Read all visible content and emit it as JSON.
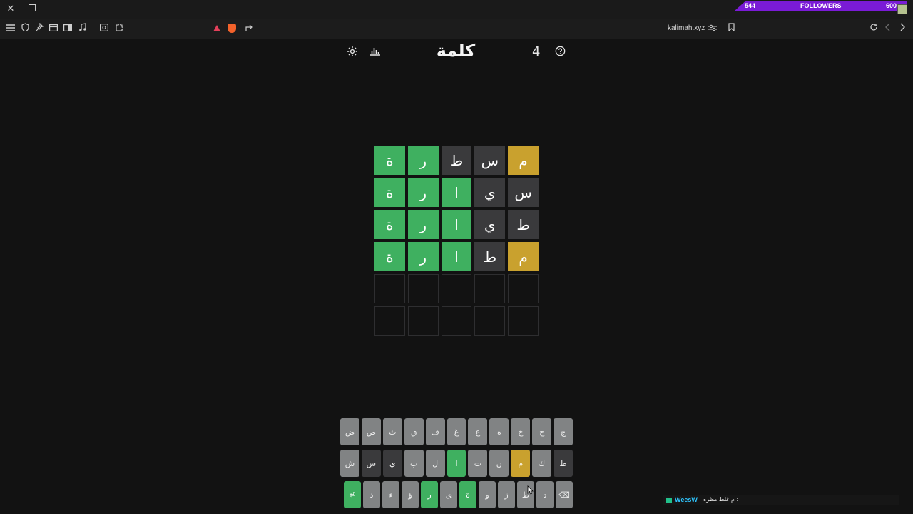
{
  "browser": {
    "url": "kalimah.xyz",
    "window_controls": {
      "close": "✕",
      "restore": "❐",
      "minimize": "–"
    },
    "toolbar_left_icons": [
      "menu-icon",
      "shield-icon",
      "pin-icon",
      "tab-icon",
      "sidebar-icon",
      "music-icon",
      "screenshot-icon",
      "puzzle-icon"
    ],
    "toolbar_right_icons": [
      "tune-icon",
      "bookmark-icon",
      "reload-icon",
      "back-icon",
      "forward-icon"
    ]
  },
  "overlay": {
    "followers_label": "FOLLOWERS",
    "followers_current": "544",
    "followers_goal": "600"
  },
  "header": {
    "title": "كلمة",
    "count": "4",
    "icons": [
      "settings-icon",
      "stats-icon",
      "help-icon"
    ]
  },
  "board": {
    "rows": [
      [
        {
          "l": "م",
          "s": "present"
        },
        {
          "l": "س",
          "s": "absent"
        },
        {
          "l": "ط",
          "s": "absent"
        },
        {
          "l": "ر",
          "s": "correct"
        },
        {
          "l": "ة",
          "s": "correct"
        }
      ],
      [
        {
          "l": "س",
          "s": "absent"
        },
        {
          "l": "ي",
          "s": "absent"
        },
        {
          "l": "ا",
          "s": "correct"
        },
        {
          "l": "ر",
          "s": "correct"
        },
        {
          "l": "ة",
          "s": "correct"
        }
      ],
      [
        {
          "l": "ط",
          "s": "absent"
        },
        {
          "l": "ي",
          "s": "absent"
        },
        {
          "l": "ا",
          "s": "correct"
        },
        {
          "l": "ر",
          "s": "correct"
        },
        {
          "l": "ة",
          "s": "correct"
        }
      ],
      [
        {
          "l": "م",
          "s": "present"
        },
        {
          "l": "ط",
          "s": "absent"
        },
        {
          "l": "ا",
          "s": "correct"
        },
        {
          "l": "ر",
          "s": "correct"
        },
        {
          "l": "ة",
          "s": "correct"
        }
      ],
      [
        {
          "l": "",
          "s": "empty"
        },
        {
          "l": "",
          "s": "empty"
        },
        {
          "l": "",
          "s": "empty"
        },
        {
          "l": "",
          "s": "empty"
        },
        {
          "l": "",
          "s": "empty"
        }
      ],
      [
        {
          "l": "",
          "s": "empty"
        },
        {
          "l": "",
          "s": "empty"
        },
        {
          "l": "",
          "s": "empty"
        },
        {
          "l": "",
          "s": "empty"
        },
        {
          "l": "",
          "s": "empty"
        }
      ]
    ]
  },
  "keyboard": {
    "rows": [
      [
        {
          "k": "ج",
          "s": "unused"
        },
        {
          "k": "ح",
          "s": "unused"
        },
        {
          "k": "خ",
          "s": "unused"
        },
        {
          "k": "ه",
          "s": "unused"
        },
        {
          "k": "ع",
          "s": "unused"
        },
        {
          "k": "غ",
          "s": "unused"
        },
        {
          "k": "ف",
          "s": "unused"
        },
        {
          "k": "ق",
          "s": "unused"
        },
        {
          "k": "ث",
          "s": "unused"
        },
        {
          "k": "ص",
          "s": "unused"
        },
        {
          "k": "ض",
          "s": "unused"
        }
      ],
      [
        {
          "k": "ط",
          "s": "absent"
        },
        {
          "k": "ك",
          "s": "unused"
        },
        {
          "k": "م",
          "s": "present"
        },
        {
          "k": "ن",
          "s": "unused"
        },
        {
          "k": "ت",
          "s": "unused"
        },
        {
          "k": "ا",
          "s": "correct"
        },
        {
          "k": "ل",
          "s": "unused"
        },
        {
          "k": "ب",
          "s": "unused"
        },
        {
          "k": "ي",
          "s": "absent"
        },
        {
          "k": "س",
          "s": "absent"
        },
        {
          "k": "ش",
          "s": "unused"
        }
      ],
      [
        {
          "k": "⌫",
          "s": "unused",
          "name": "backspace-key"
        },
        {
          "k": "د",
          "s": "unused"
        },
        {
          "k": "ظ",
          "s": "unused"
        },
        {
          "k": "ز",
          "s": "unused"
        },
        {
          "k": "و",
          "s": "unused"
        },
        {
          "k": "ة",
          "s": "correct"
        },
        {
          "k": "ى",
          "s": "unused"
        },
        {
          "k": "ر",
          "s": "correct"
        },
        {
          "k": "ؤ",
          "s": "unused"
        },
        {
          "k": "ء",
          "s": "unused"
        },
        {
          "k": "ذ",
          "s": "unused"
        },
        {
          "k": "⏎",
          "s": "correct",
          "name": "enter-key"
        }
      ]
    ]
  },
  "chat": {
    "username": "WeesW",
    "message": "م غلط مظره :"
  },
  "colors": {
    "correct": "#3fb060",
    "present": "#c9a12e",
    "absent": "#3a3a3c",
    "background": "#121212",
    "followers_bar": "#7a1bd6"
  }
}
